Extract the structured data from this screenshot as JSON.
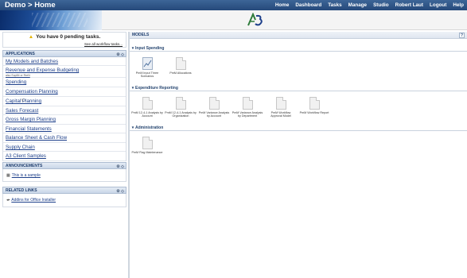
{
  "topbar": {
    "title": "Demo > Home",
    "nav": [
      "Home",
      "Dashboard",
      "Tasks",
      "Manage",
      "Studio",
      "Robert Laut",
      "Logout",
      "Help"
    ]
  },
  "banner": {
    "logo_text": "A3"
  },
  "tasks": {
    "message": "You have 0 pending tasks.",
    "link": "See all workflow tasks..."
  },
  "applications": {
    "title": "APPLICATIONS",
    "items": [
      {
        "label": "My Models and Batches"
      },
      {
        "label": "Revenue and Expense Budgeting",
        "sub": "also Sup84 or RreN"
      },
      {
        "label": "Spending"
      },
      {
        "label": "Compensation Planning"
      },
      {
        "label": "Capital Planning"
      },
      {
        "label": "Sales Forecast"
      },
      {
        "label": "Gross Margin Planning"
      },
      {
        "label": "Financial Statements"
      },
      {
        "label": "Balance Sheet & Cash Flow"
      },
      {
        "label": "Supply Chain"
      },
      {
        "label": "A3 Client Samples"
      }
    ]
  },
  "announcements": {
    "title": "ANNOUNCEMENTS",
    "item": "This is a sample"
  },
  "related_links": {
    "title": "RELATED LINKS",
    "item": "Addins for Office Installer"
  },
  "models": {
    "title": "MODELS",
    "help": "?",
    "sections": [
      {
        "name": "Input Spending",
        "tiles": [
          {
            "label": "PmM Input Three Scenarios",
            "icon": "chart-doc-icon"
          },
          {
            "label": "PmM Allocations",
            "icon": "doc-icon"
          }
        ]
      },
      {
        "name": "Expenditure Reporting",
        "tiles": [
          {
            "label": "PmM 12-4-1 Analysis by Account",
            "icon": "doc-icon"
          },
          {
            "label": "PmM 12-4-1 Analysis by Organization",
            "icon": "doc-icon"
          },
          {
            "label": "PmM Variance Analysis by Account",
            "icon": "doc-icon"
          },
          {
            "label": "PmM Variance Analysis by Department",
            "icon": "doc-icon"
          },
          {
            "label": "PmM Workflow Approval Model",
            "icon": "doc-icon"
          },
          {
            "label": "PmM Workflow Report",
            "icon": "doc-icon"
          }
        ]
      },
      {
        "name": "Administration",
        "tiles": [
          {
            "label": "PmM Flag Maintenance",
            "icon": "doc-icon"
          }
        ]
      }
    ]
  },
  "panel_controls": {
    "settings": "⚙",
    "collapse": "◇"
  }
}
